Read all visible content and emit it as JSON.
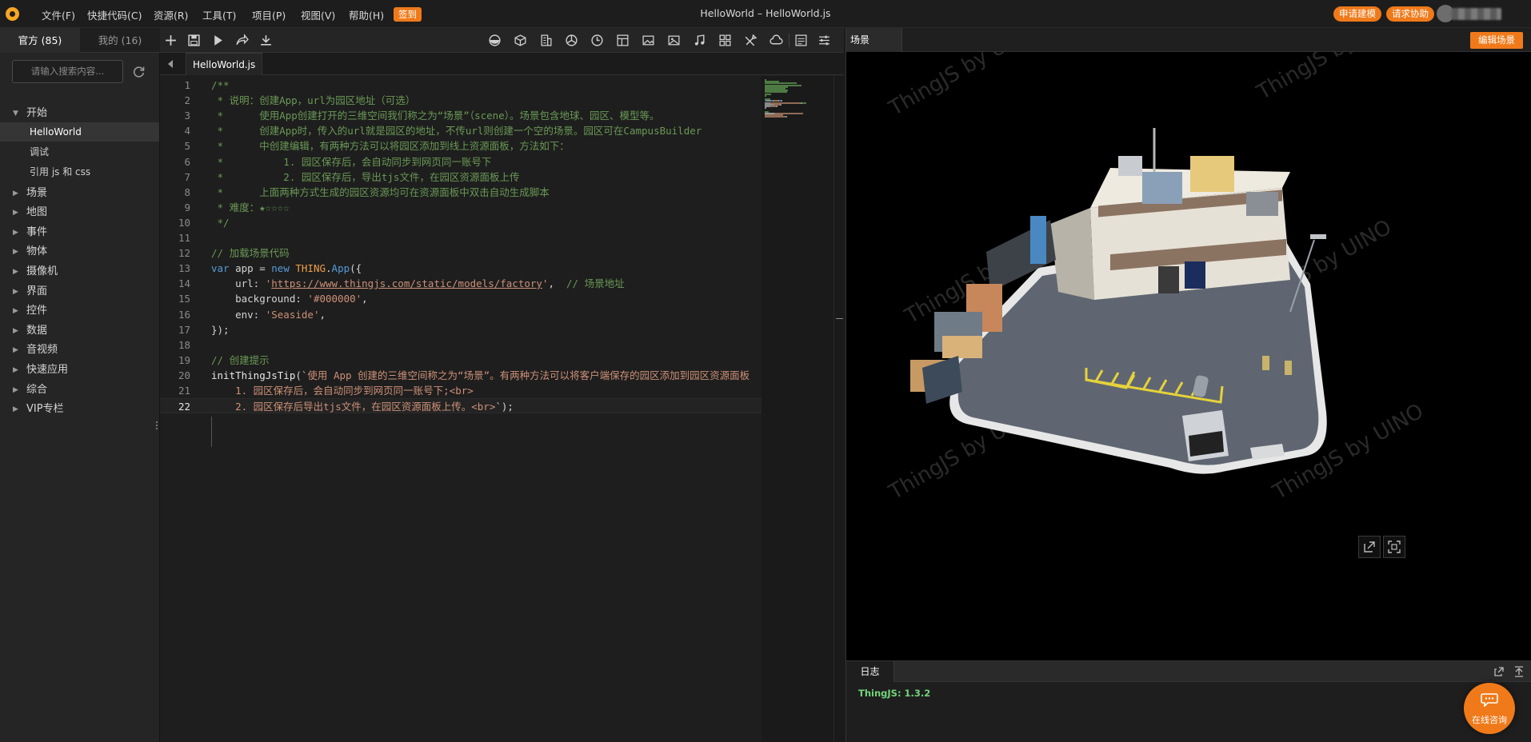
{
  "menubar": {
    "items": [
      "文件(F)",
      "快捷代码(C)",
      "资源(R)",
      "工具(T)",
      "项目(P)",
      "视图(V)",
      "帮助(H)"
    ],
    "checkin_label": "签到",
    "window_title": "HelloWorld –  HelloWorld.js",
    "apply_modeling_label": "申请建模",
    "request_help_label": "请求协助"
  },
  "sidebar": {
    "tabs": [
      {
        "label": "官方 (85)",
        "active": true
      },
      {
        "label": "我的 (16)",
        "active": false
      }
    ],
    "search": {
      "placeholder": "请输入搜索内容...",
      "value": ""
    },
    "tree": [
      {
        "label": "开始",
        "expanded": true,
        "children": [
          {
            "label": "HelloWorld",
            "selected": true
          },
          {
            "label": "调试",
            "selected": false
          },
          {
            "label": "引用 js 和 css",
            "selected": false
          }
        ]
      },
      {
        "label": "场景",
        "expanded": false
      },
      {
        "label": "地图",
        "expanded": false
      },
      {
        "label": "事件",
        "expanded": false
      },
      {
        "label": "物体",
        "expanded": false
      },
      {
        "label": "摄像机",
        "expanded": false
      },
      {
        "label": "界面",
        "expanded": false
      },
      {
        "label": "控件",
        "expanded": false
      },
      {
        "label": "数据",
        "expanded": false
      },
      {
        "label": "音视频",
        "expanded": false
      },
      {
        "label": "快速应用",
        "expanded": false
      },
      {
        "label": "综合",
        "expanded": false
      },
      {
        "label": "VIP专栏",
        "expanded": false
      }
    ]
  },
  "editor": {
    "file_tab": "HelloWorld.js",
    "current_line": 22,
    "lines": [
      {
        "n": 1,
        "parts": [
          [
            "c-comment",
            "/**"
          ]
        ]
      },
      {
        "n": 2,
        "parts": [
          [
            "c-comment",
            " * 说明：创建App，url为园区地址（可选）"
          ]
        ]
      },
      {
        "n": 3,
        "parts": [
          [
            "c-comment",
            " *      使用App创建打开的三维空间我们称之为“场景”（scene）。场景包含地球、园区、模型等。"
          ]
        ]
      },
      {
        "n": 4,
        "parts": [
          [
            "c-comment",
            " *      创建App时，传入的url就是园区的地址，不传url则创建一个空的场景。园区可在CampusBuilder"
          ]
        ]
      },
      {
        "n": 5,
        "parts": [
          [
            "c-comment",
            " *      中创建编辑，有两种方法可以将园区添加到线上资源面板，方法如下："
          ]
        ]
      },
      {
        "n": 6,
        "parts": [
          [
            "c-comment",
            " *          1. 园区保存后，会自动同步到网页同一账号下"
          ]
        ]
      },
      {
        "n": 7,
        "parts": [
          [
            "c-comment",
            " *          2. 园区保存后，导出tjs文件，在园区资源面板上传"
          ]
        ]
      },
      {
        "n": 8,
        "parts": [
          [
            "c-comment",
            " *      上面两种方式生成的园区资源均可在资源面板中双击自动生成脚本"
          ]
        ]
      },
      {
        "n": 9,
        "parts": [
          [
            "c-comment",
            " * 难度：★☆☆☆☆"
          ]
        ]
      },
      {
        "n": 10,
        "parts": [
          [
            "c-comment",
            " */"
          ]
        ]
      },
      {
        "n": 11,
        "parts": []
      },
      {
        "n": 12,
        "parts": [
          [
            "c-comment",
            "// 加载场景代码"
          ]
        ]
      },
      {
        "n": 13,
        "parts": [
          [
            "c-keyword",
            "var"
          ],
          [
            "c-ident",
            " app = "
          ],
          [
            "c-keyword",
            "new"
          ],
          [
            "c-ident",
            " "
          ],
          [
            "c-const",
            "THING"
          ],
          [
            "c-ident",
            "."
          ],
          [
            "c-keyword",
            "App"
          ],
          [
            "c-ident",
            "({"
          ]
        ]
      },
      {
        "n": 14,
        "parts": [
          [
            "c-ident",
            "    url: "
          ],
          [
            "c-string",
            "'"
          ],
          [
            "c-url",
            "https://www.thingjs.com/static/models/factory"
          ],
          [
            "c-string",
            "'"
          ],
          [
            "c-ident",
            ",  "
          ],
          [
            "c-comment",
            "// 场景地址"
          ]
        ]
      },
      {
        "n": 15,
        "parts": [
          [
            "c-ident",
            "    background: "
          ],
          [
            "c-string",
            "'#000000'"
          ],
          [
            "c-ident",
            ","
          ]
        ]
      },
      {
        "n": 16,
        "parts": [
          [
            "c-ident",
            "    env: "
          ],
          [
            "c-string",
            "'Seaside'"
          ],
          [
            "c-ident",
            ","
          ]
        ]
      },
      {
        "n": 17,
        "parts": [
          [
            "c-ident",
            "});"
          ]
        ]
      },
      {
        "n": 18,
        "parts": []
      },
      {
        "n": 19,
        "parts": [
          [
            "c-comment",
            "// 创建提示"
          ]
        ]
      },
      {
        "n": 20,
        "parts": [
          [
            "c-fn",
            "initThingJsTip"
          ],
          [
            "c-ident",
            "(`"
          ],
          [
            "c-string",
            "使用 App 创建的三维空间称之为“场景”。有两种方法可以将客户端保存的园区添加到园区资源面板"
          ]
        ]
      },
      {
        "n": 21,
        "parts": [
          [
            "c-string",
            "    1. 园区保存后，会自动同步到网页同一账号下;<br>"
          ]
        ]
      },
      {
        "n": 22,
        "parts": [
          [
            "c-string",
            "    2. 园区保存后导出tjs文件，在园区资源面板上传。<br>"
          ],
          [
            "c-ident",
            "`);"
          ]
        ]
      }
    ]
  },
  "scene": {
    "tab_label": "场景",
    "edit_button_label": "编辑场景",
    "watermark": "ThingJS by UINO"
  },
  "log": {
    "tab_label": "日志",
    "version_line": "ThingJS: 1.3.2"
  },
  "consult": {
    "label": "在线咨询"
  },
  "colors": {
    "accent": "#f07a1a",
    "log_text": "#74d47a",
    "comment": "#6a9955"
  }
}
